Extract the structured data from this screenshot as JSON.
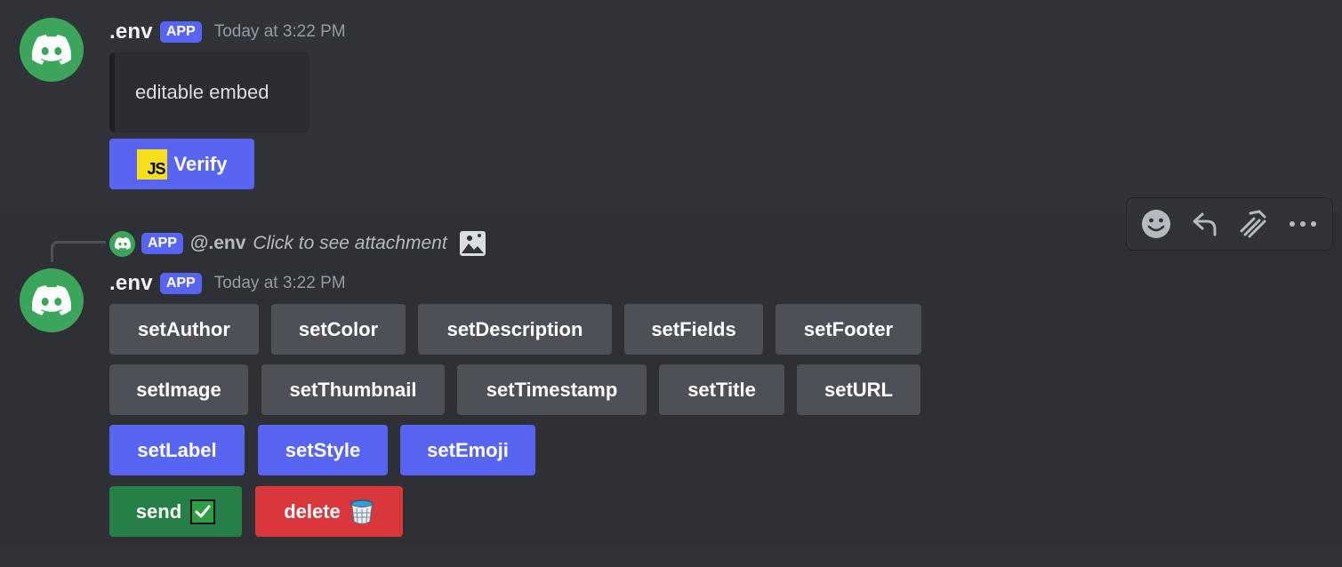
{
  "message1": {
    "username": ".env",
    "badge": "APP",
    "timestamp": "Today at 3:22 PM",
    "embed_text": "editable embed",
    "verify_button": {
      "label": "Verify",
      "emoji_text": "JS"
    }
  },
  "reply": {
    "badge": "APP",
    "author": "@.env",
    "text": "Click to see attachment"
  },
  "message2": {
    "username": ".env",
    "badge": "APP",
    "timestamp": "Today at 3:22 PM",
    "rows": [
      [
        "setAuthor",
        "setColor",
        "setDescription",
        "setFields",
        "setFooter"
      ],
      [
        "setImage",
        "setThumbnail",
        "setTimestamp",
        "setTitle",
        "setURL"
      ],
      [
        "setLabel",
        "setStyle",
        "setEmoji"
      ],
      [
        "send",
        "delete"
      ]
    ]
  },
  "colors": {
    "background": "#313338",
    "blurple": "#5865f2",
    "grey_button": "#4e5058",
    "success": "#248046",
    "danger": "#da373c",
    "avatar": "#3ba55c"
  },
  "toolbar": {
    "icons": [
      "add-reaction-icon",
      "reply-icon",
      "create-thread-icon",
      "more-icon"
    ]
  }
}
